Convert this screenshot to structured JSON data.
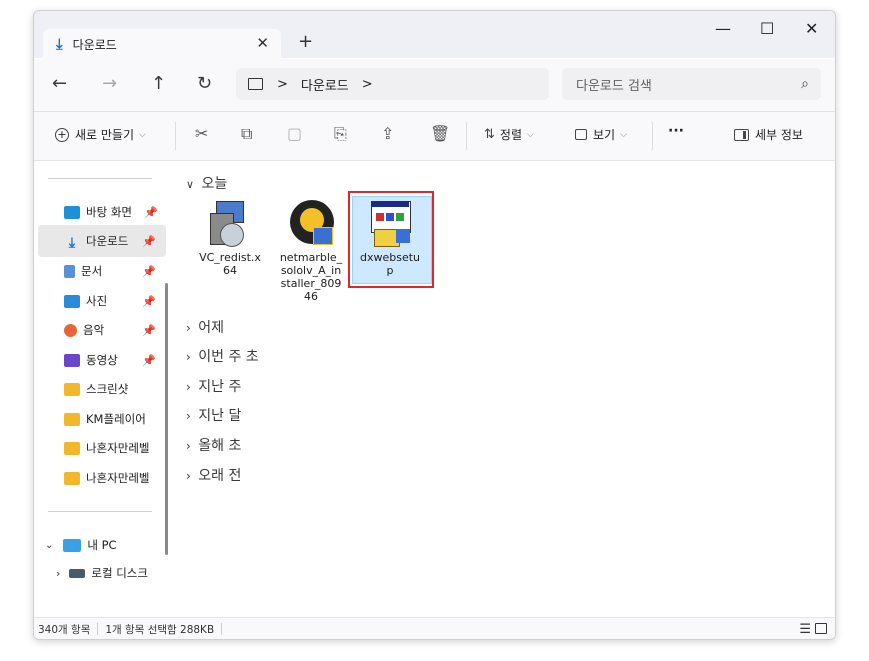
{
  "window": {
    "tab_title": "다운로드",
    "tab_close": "✕",
    "new_tab": "+",
    "minimize": "—",
    "maximize": "☐",
    "close": "✕"
  },
  "navbar": {
    "back": "←",
    "forward": "→",
    "up": "↑",
    "refresh": "↻",
    "breadcrumb_sep": ">",
    "breadcrumb": "다운로드",
    "search_placeholder": "다운로드 검색",
    "search_icon": "⌕"
  },
  "toolbar": {
    "new_label": "새로 만들기",
    "sort_label": "정렬",
    "view_label": "보기",
    "more": "···",
    "details_label": "세부 정보"
  },
  "sidebar": {
    "items": [
      {
        "label": "바탕 화면",
        "icon": "desktop-icon",
        "pinned": true
      },
      {
        "label": "다운로드",
        "icon": "download-icon",
        "pinned": true
      },
      {
        "label": "문서",
        "icon": "document-icon",
        "pinned": true
      },
      {
        "label": "사진",
        "icon": "pictures-icon",
        "pinned": true
      },
      {
        "label": "음악",
        "icon": "music-icon",
        "pinned": true
      },
      {
        "label": "동영상",
        "icon": "videos-icon",
        "pinned": true
      },
      {
        "label": "스크린샷",
        "icon": "folder-icon",
        "pinned": false
      },
      {
        "label": "KM플레이어",
        "icon": "folder-icon",
        "pinned": false
      },
      {
        "label": "나혼자만레벨",
        "icon": "folder-icon",
        "pinned": false
      },
      {
        "label": "나혼자만레벨",
        "icon": "folder-icon",
        "pinned": false
      }
    ],
    "pc_label": "내 PC",
    "disk_label": "로컬 디스크"
  },
  "content": {
    "groups": [
      {
        "label": "오늘",
        "expanded": true
      },
      {
        "label": "어제",
        "expanded": false
      },
      {
        "label": "이번 주 초",
        "expanded": false
      },
      {
        "label": "지난 주",
        "expanded": false
      },
      {
        "label": "지난 달",
        "expanded": false
      },
      {
        "label": "올해 초",
        "expanded": false
      },
      {
        "label": "오래 전",
        "expanded": false
      }
    ],
    "files": [
      {
        "name": "VC_redist.x64",
        "line1": "VC_redist.x",
        "line2": "64"
      },
      {
        "name": "netmarble_sololv_A_installer_80946",
        "line1": "netmarble_",
        "line2": "sololv_A_in",
        "line3": "staller_809",
        "line4": "46"
      },
      {
        "name": "dxwebsetup",
        "line1": "dxwebsetu",
        "line2": "p",
        "selected": true
      }
    ]
  },
  "status": {
    "item_count": "340개 항목",
    "selection": "1개 항목 선택함 288KB"
  },
  "colors": {
    "accent": "#1f6fd0",
    "selection_fill": "#cde8ff",
    "highlight_box": "#d92b2b",
    "folder": "#f2b82c"
  }
}
